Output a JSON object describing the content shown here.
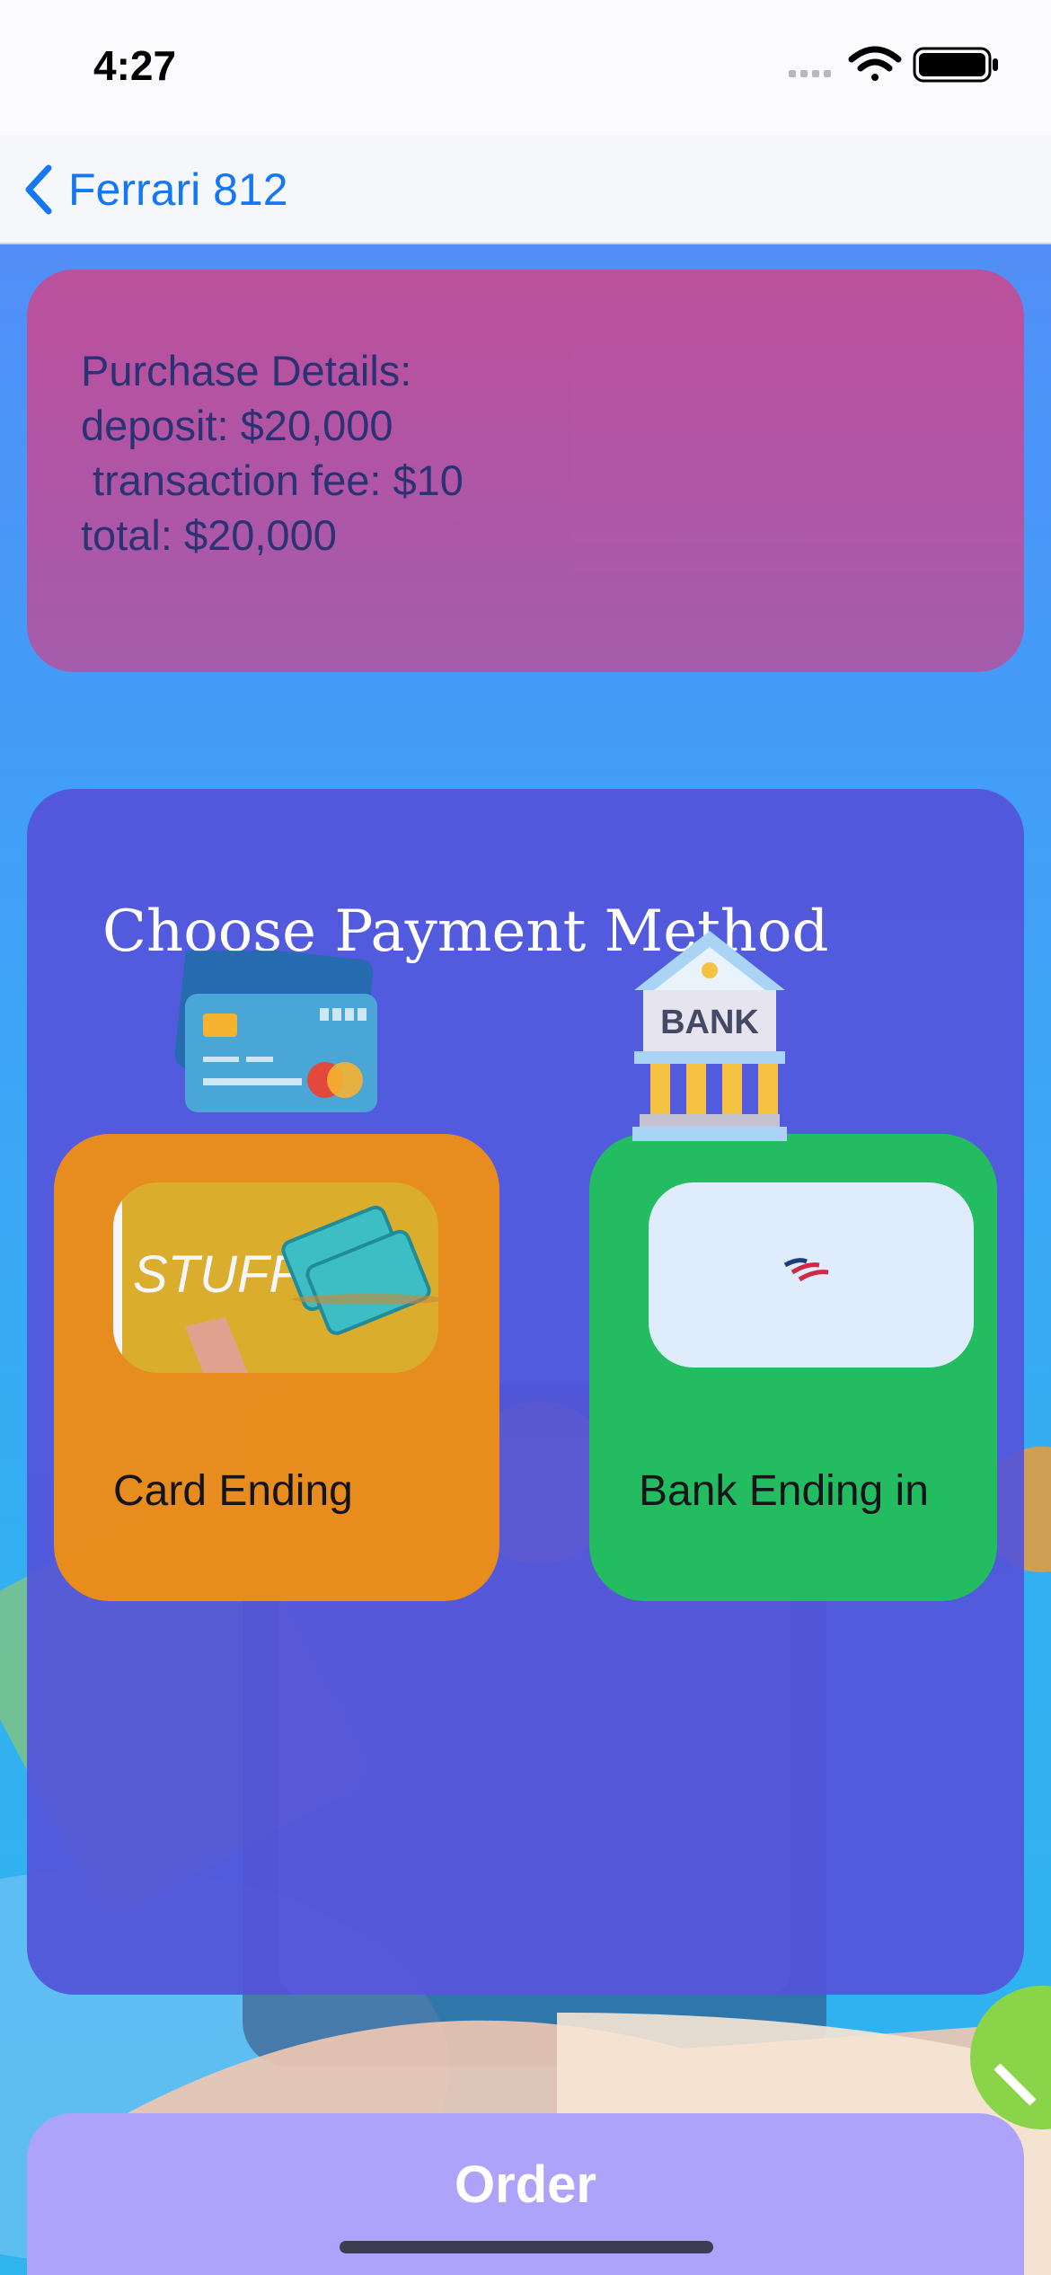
{
  "status_bar": {
    "time": "4:27",
    "icons": [
      "signal-icon",
      "wifi-icon",
      "battery-icon"
    ]
  },
  "nav": {
    "back_label": "Ferrari 812",
    "back_icon": "chevron-left-icon"
  },
  "purchase_details": {
    "text": "Purchase Details:\ndeposit: $20,000\n transaction fee: $10\ntotal: $20,000"
  },
  "payment": {
    "title": "Choose Payment Method",
    "options": [
      {
        "label": "Card Ending",
        "image_text": "STUFF",
        "image_icon": "tickets-icon",
        "color": "#f08f14"
      },
      {
        "label": "Bank Ending in",
        "image_icon": "bank-logo-icon",
        "color": "#22c25a"
      }
    ],
    "icons": [
      "credit-card-icon",
      "bank-building-icon"
    ],
    "bank_sign": "BANK"
  },
  "order_button": {
    "label": "Order",
    "color": "#ada3fb"
  },
  "colors": {
    "accent_blue": "#1478f5",
    "purchase_card": "#b354a4",
    "panel": "#5454da",
    "text_dark": "#2a2f6e"
  }
}
